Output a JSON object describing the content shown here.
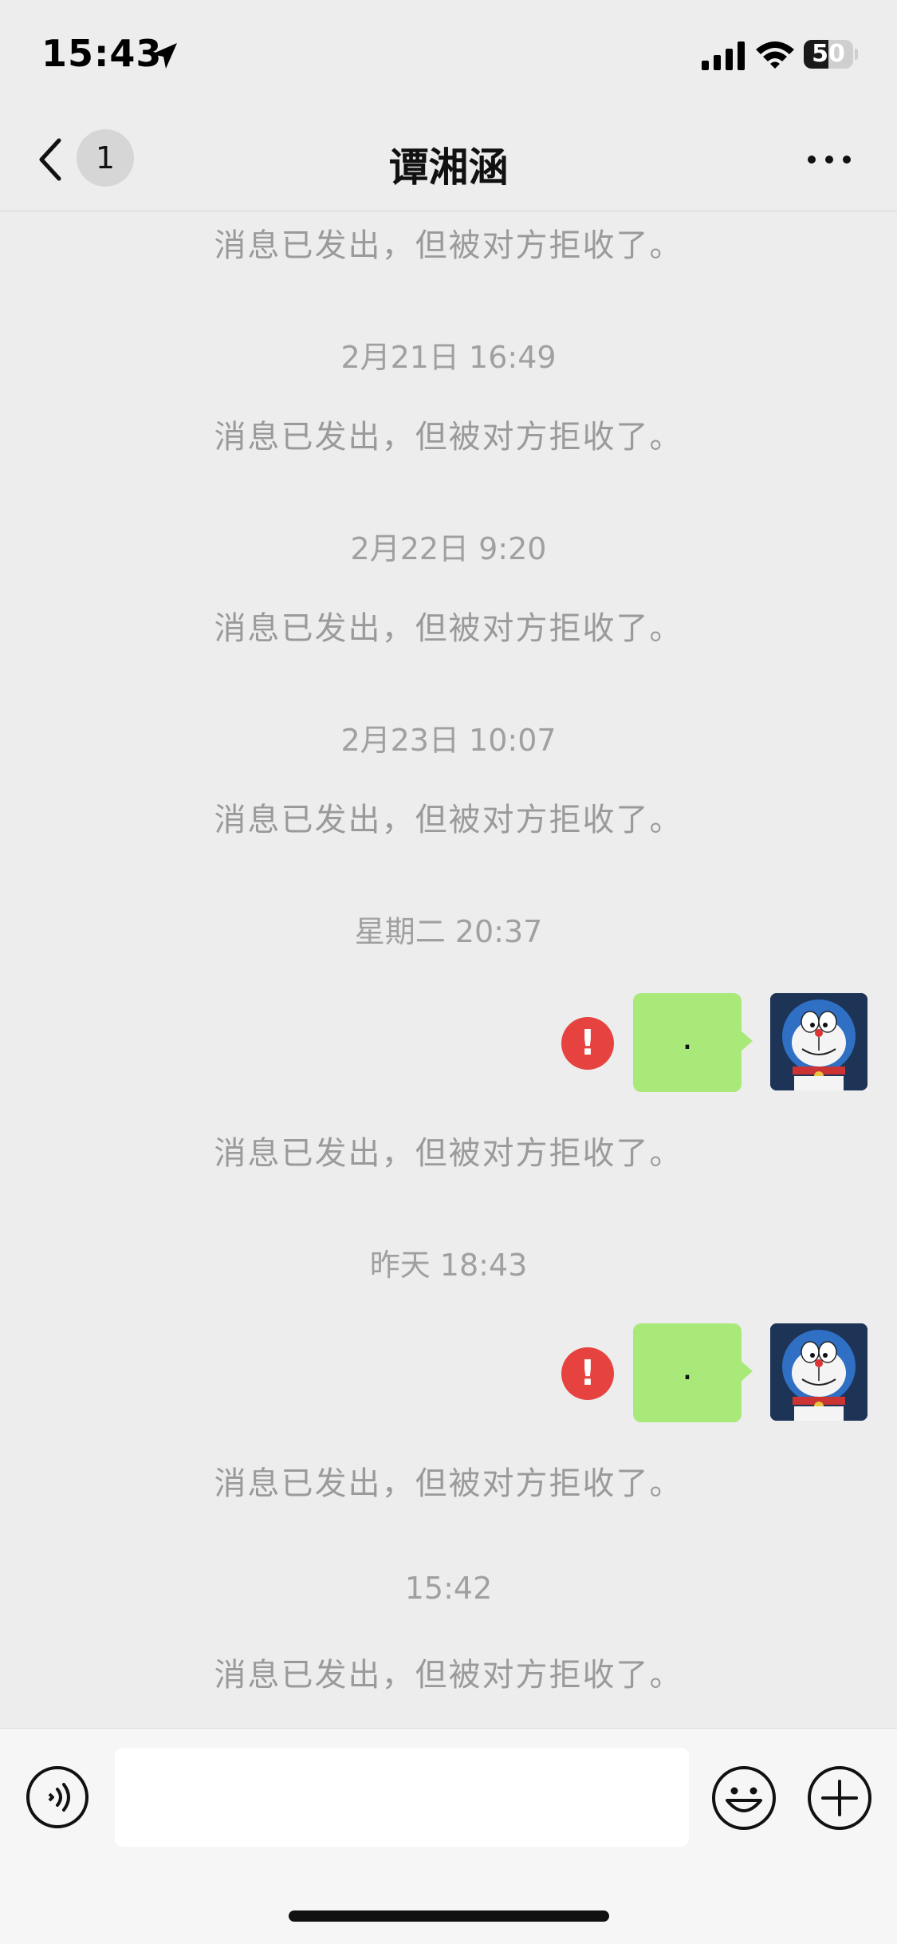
{
  "status_bar": {
    "time": "15:43",
    "battery_level": "50",
    "battery_fraction": 0.5
  },
  "nav": {
    "unread_count": "1",
    "title": "谭湘涵"
  },
  "chat": {
    "items": [
      {
        "kind": "system",
        "text": "消息已发出，但被对方拒收了。"
      },
      {
        "kind": "time",
        "text": "2月21日 16:49"
      },
      {
        "kind": "system",
        "text": "消息已发出，但被对方拒收了。"
      },
      {
        "kind": "time",
        "text": "2月22日 9:20"
      },
      {
        "kind": "system",
        "text": "消息已发出，但被对方拒收了。"
      },
      {
        "kind": "time",
        "text": "2月23日 10:07"
      },
      {
        "kind": "system",
        "text": "消息已发出，但被对方拒收了。"
      },
      {
        "kind": "time",
        "text": "星期二 20:37"
      },
      {
        "kind": "message",
        "text": ".",
        "status": "failed"
      },
      {
        "kind": "system",
        "text": "消息已发出，但被对方拒收了。"
      },
      {
        "kind": "time",
        "text": "昨天 18:43"
      },
      {
        "kind": "message",
        "text": ".",
        "status": "failed"
      },
      {
        "kind": "system",
        "text": "消息已发出，但被对方拒收了。"
      },
      {
        "kind": "time",
        "text": "15:42"
      },
      {
        "kind": "system",
        "text": "消息已发出，但被对方拒收了。"
      }
    ],
    "error_mark": "!"
  },
  "input_bar": {
    "placeholder": "",
    "icons": [
      "voice-icon",
      "emoji-icon",
      "plus-icon"
    ]
  },
  "colors": {
    "background": "#ededed",
    "bubble": "#a9e97a",
    "error": "#e64340",
    "system_text": "#9a9a9a"
  }
}
